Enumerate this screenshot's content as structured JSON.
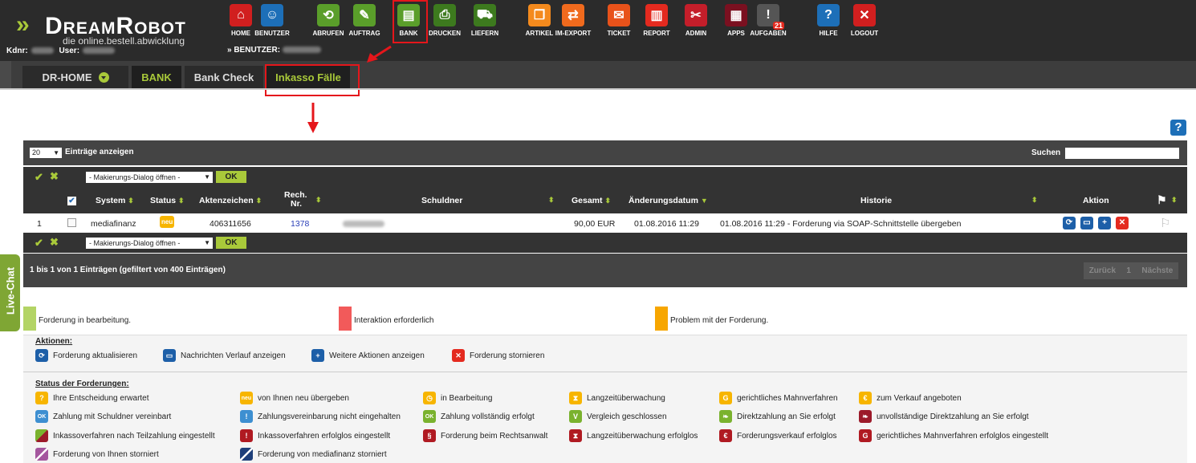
{
  "brand": {
    "name": "DreamRobot",
    "tagline": "die online.bestell.abwicklung",
    "kdnr_label": "Kdnr:",
    "user_label": "User:",
    "benutzer_line": "» BENUTZER:"
  },
  "nav": [
    {
      "label": "HOME",
      "color": "#d11f1f",
      "icon": "home-icon",
      "glyph": "⌂"
    },
    {
      "label": "BENUTZER",
      "color": "#1d6fb8",
      "icon": "user-icon",
      "glyph": "☺"
    },
    {
      "label": "ABRUFEN",
      "color": "#5a9e2a",
      "icon": "download-icon",
      "glyph": "⟲"
    },
    {
      "label": "AUFTRAG",
      "color": "#5a9e2a",
      "icon": "order-icon",
      "glyph": "✎"
    },
    {
      "label": "BANK",
      "color": "#5a9e2a",
      "icon": "bank-icon",
      "glyph": "▤"
    },
    {
      "label": "DRUCKEN",
      "color": "#3d7a1e",
      "icon": "printer-icon",
      "glyph": "⎙"
    },
    {
      "label": "LIEFERN",
      "color": "#3d7a1e",
      "icon": "delivery-icon",
      "glyph": "⛟"
    },
    {
      "label": "ARTIKEL",
      "color": "#f48a1d",
      "icon": "box-icon",
      "glyph": "❒"
    },
    {
      "label": "IM-EXPORT",
      "color": "#f06a1d",
      "icon": "sync-icon",
      "glyph": "⇄"
    },
    {
      "label": "TICKET",
      "color": "#e8521a",
      "icon": "mail-icon",
      "glyph": "✉"
    },
    {
      "label": "REPORT",
      "color": "#e42a1f",
      "icon": "chart-icon",
      "glyph": "▥"
    },
    {
      "label": "ADMIN",
      "color": "#c41e2a",
      "icon": "tools-icon",
      "glyph": "✂"
    },
    {
      "label": "APPS",
      "color": "#7a1020",
      "icon": "apps-icon",
      "glyph": "▦"
    },
    {
      "label": "AUFGABEN",
      "color": "#555555",
      "icon": "tasks-icon",
      "glyph": "!",
      "badge": "21"
    },
    {
      "label": "HILFE",
      "color": "#1d6fb8",
      "icon": "help-icon",
      "glyph": "?"
    },
    {
      "label": "LOGOUT",
      "color": "#d11f1f",
      "icon": "logout-icon",
      "glyph": "✕"
    }
  ],
  "tabs": [
    {
      "label": "DR-HOME"
    },
    {
      "label": "BANK"
    },
    {
      "label": "Bank Check"
    },
    {
      "label": "Inkasso Fälle"
    }
  ],
  "table": {
    "page_size": "20",
    "entries_label": "Einträge anzeigen",
    "search_label": "Suchen",
    "dialog_label": "- Makierungs-Dialog öffnen -",
    "ok_label": "OK",
    "columns": {
      "system": "System",
      "status": "Status",
      "aktenzeichen": "Aktenzeichen",
      "rech1": "Rech.",
      "rech2": "Nr.",
      "schuldner": "Schuldner",
      "gesamt": "Gesamt",
      "datum": "Änderungsdatum",
      "historie": "Historie",
      "aktion": "Aktion"
    },
    "row": {
      "index": "1",
      "system": "mediafinanz",
      "status": "neu",
      "aktenzeichen": "406311656",
      "rechnr": "1378",
      "gesamt": "90,00 EUR",
      "datum": "01.08.2016 11:29",
      "historie": "01.08.2016 11:29 - Forderung via SOAP-Schnittstelle übergeben"
    },
    "info": "1 bis 1 von 1 Einträgen (gefiltert von 400 Einträgen)",
    "prev": "Zurück",
    "page": "1",
    "next": "Nächste"
  },
  "legend": [
    {
      "color": "#b3d465",
      "text": "Forderung in bearbeitung."
    },
    {
      "color": "#f25a5a",
      "text": "Interaktion erforderlich"
    },
    {
      "color": "#f7a600",
      "text": "Problem mit der Forderung."
    }
  ],
  "aktionen": {
    "title": "Aktionen:",
    "items": [
      {
        "icon": "refresh-icon",
        "color": "#1d5fa8",
        "glyph": "⟳",
        "text": "Forderung aktualisieren"
      },
      {
        "icon": "message-icon",
        "color": "#1d5fa8",
        "glyph": "▭",
        "text": "Nachrichten Verlauf anzeigen"
      },
      {
        "icon": "plus-icon",
        "color": "#1d5fa8",
        "glyph": "+",
        "text": "Weitere Aktionen anzeigen"
      },
      {
        "icon": "cancel-icon",
        "color": "#e42a1f",
        "glyph": "✕",
        "text": "Forderung stornieren"
      }
    ]
  },
  "status": {
    "title": "Status der Forderungen:",
    "items": [
      {
        "icon": "question-icon",
        "color": "#f7b500",
        "glyph": "?",
        "text": "Ihre Entscheidung erwartet"
      },
      {
        "icon": "neu-icon",
        "color": "#f7b500",
        "glyph": "neu",
        "text": "von Ihnen neu übergeben"
      },
      {
        "icon": "clock-icon",
        "color": "#f7b500",
        "glyph": "◷",
        "text": "in Bearbeitung"
      },
      {
        "icon": "hourglass-icon",
        "color": "#f7b500",
        "glyph": "⧗",
        "text": "Langzeitüberwachung"
      },
      {
        "icon": "g-icon",
        "color": "#f7b500",
        "glyph": "G",
        "text": "gerichtliches Mahnverfahren"
      },
      {
        "icon": "euro-icon",
        "color": "#f7b500",
        "glyph": "€",
        "text": "zum Verkauf angeboten"
      },
      {
        "icon": "ok-icon",
        "color": "#3d8fd1",
        "glyph": "OK",
        "text": "Zahlung mit Schuldner vereinbart"
      },
      {
        "icon": "exclamation-icon",
        "color": "#3d8fd1",
        "glyph": "!",
        "text": "Zahlungsvereinbarung nicht eingehalten"
      },
      {
        "icon": "ok-green-icon",
        "color": "#7ab22e",
        "glyph": "OK",
        "text": "Zahlung vollständig erfolgt"
      },
      {
        "icon": "v-icon",
        "color": "#7ab22e",
        "glyph": "V",
        "text": "Vergleich geschlossen"
      },
      {
        "icon": "money-icon",
        "color": "#7ab22e",
        "glyph": "❧",
        "text": "Direktzahlung an Sie erfolgt"
      },
      {
        "icon": "money-partial-icon",
        "color": "#9c1a2a",
        "glyph": "❧",
        "text": "unvollständige Direktzahlung an Sie erfolgt"
      },
      {
        "icon": "split-green-red-icon",
        "color": "#9c1a2a",
        "glyph": "",
        "text": "Inkassoverfahren nach Teilzahlung eingestellt"
      },
      {
        "icon": "exclamation-red-icon",
        "color": "#b01a22",
        "glyph": "!",
        "text": "Inkassoverfahren erfolglos eingestellt"
      },
      {
        "icon": "paragraph-icon",
        "color": "#b01a22",
        "glyph": "§",
        "text": "Forderung beim Rechtsanwalt"
      },
      {
        "icon": "hourglass-red-icon",
        "color": "#b01a22",
        "glyph": "⧗",
        "text": "Langzeitüberwachung erfolglos"
      },
      {
        "icon": "euro-red-icon",
        "color": "#b01a22",
        "glyph": "€",
        "text": "Forderungsverkauf erfolglos"
      },
      {
        "icon": "g-red-icon",
        "color": "#b01a22",
        "glyph": "G",
        "text": "gerichtliches Mahnverfahren erfolglos eingestellt"
      },
      {
        "icon": "cancel-purple-icon",
        "color": "#a4569e",
        "glyph": "",
        "text": "Forderung von Ihnen storniert"
      },
      {
        "icon": "cancel-blue-icon",
        "color": "#1e3f7a",
        "glyph": "",
        "text": "Forderung von mediafinanz storniert"
      }
    ]
  },
  "livechat": "Live-Chat"
}
